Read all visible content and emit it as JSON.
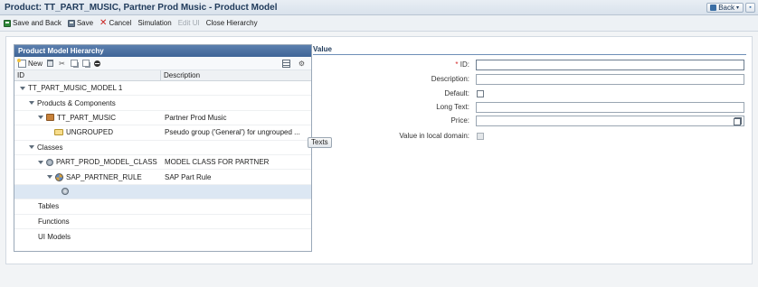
{
  "window": {
    "title": "Product: TT_PART_MUSIC, Partner Prod Music - Product Model",
    "back_label": "Back"
  },
  "toolbar": {
    "save_and_back": "Save and Back",
    "save": "Save",
    "cancel": "Cancel",
    "simulation": "Simulation",
    "edit_ui": "Edit UI",
    "close_hierarchy": "Close Hierarchy"
  },
  "hierarchy": {
    "title": "Product Model Hierarchy",
    "new_label": "New",
    "columns": {
      "id": "ID",
      "description": "Description"
    },
    "rows": [
      {
        "id": "TT_PART_MUSIC_MODEL 1",
        "description": ""
      },
      {
        "id": "Products & Components",
        "description": ""
      },
      {
        "id": "TT_PART_MUSIC",
        "description": "Partner Prod Music"
      },
      {
        "id": "UNGROUPED",
        "description": "Pseudo group ('General') for ungrouped ..."
      },
      {
        "id": "Classes",
        "description": ""
      },
      {
        "id": "PART_PROD_MODEL_CLASS",
        "description": "MODEL CLASS FOR PARTNER"
      },
      {
        "id": "SAP_PARTNER_RULE",
        "description": "SAP Part Rule"
      },
      {
        "id": "",
        "description": ""
      },
      {
        "id": "Tables",
        "description": ""
      },
      {
        "id": "Functions",
        "description": ""
      },
      {
        "id": "UI Models",
        "description": ""
      }
    ]
  },
  "texts_button": "Texts",
  "value": {
    "title": "Value",
    "id_required": "*",
    "id_label": "ID:",
    "description_label": "Description:",
    "default_label": "Default:",
    "long_text_label": "Long Text:",
    "price_label": "Price:",
    "local_domain_label": "Value in local domain:",
    "id_value": "",
    "description_value": "",
    "long_text_value": "",
    "price_value": ""
  }
}
